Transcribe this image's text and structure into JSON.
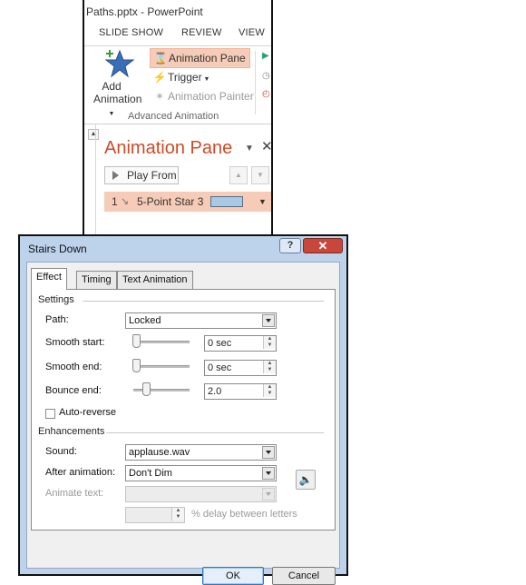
{
  "ppt": {
    "title": "Paths.pptx - PowerPoint",
    "tabs": [
      "SLIDE SHOW",
      "REVIEW",
      "VIEW"
    ],
    "add_animation": {
      "line1": "Add",
      "line2": "Animation"
    },
    "advanced_buttons": [
      "Animation Pane",
      "Trigger",
      "Animation Painter"
    ],
    "group_label": "Advanced Animation",
    "pane": {
      "title": "Animation Pane",
      "play_label": "Play From",
      "item": {
        "number": "1",
        "label": "5-Point Star 3"
      }
    }
  },
  "dialog": {
    "title": "Stairs Down",
    "tabs": [
      "Effect",
      "Timing",
      "Text Animation"
    ],
    "settings_label": "Settings",
    "path": {
      "label": "Path:",
      "value": "Locked"
    },
    "smooth_start": {
      "label": "Smooth start:",
      "value": "0 sec"
    },
    "smooth_end": {
      "label": "Smooth end:",
      "value": "0 sec"
    },
    "bounce_end": {
      "label": "Bounce end:",
      "value": "2.0"
    },
    "auto_reverse": {
      "label": "Auto-reverse",
      "checked": false
    },
    "enhancements_label": "Enhancements",
    "sound": {
      "label": "Sound:",
      "value": "applause.wav"
    },
    "after_animation": {
      "label": "After animation:",
      "value": "Don't Dim"
    },
    "animate_text": {
      "label": "Animate text:",
      "value": ""
    },
    "delay_label": "% delay between letters",
    "ok_label": "OK",
    "cancel_label": "Cancel"
  }
}
